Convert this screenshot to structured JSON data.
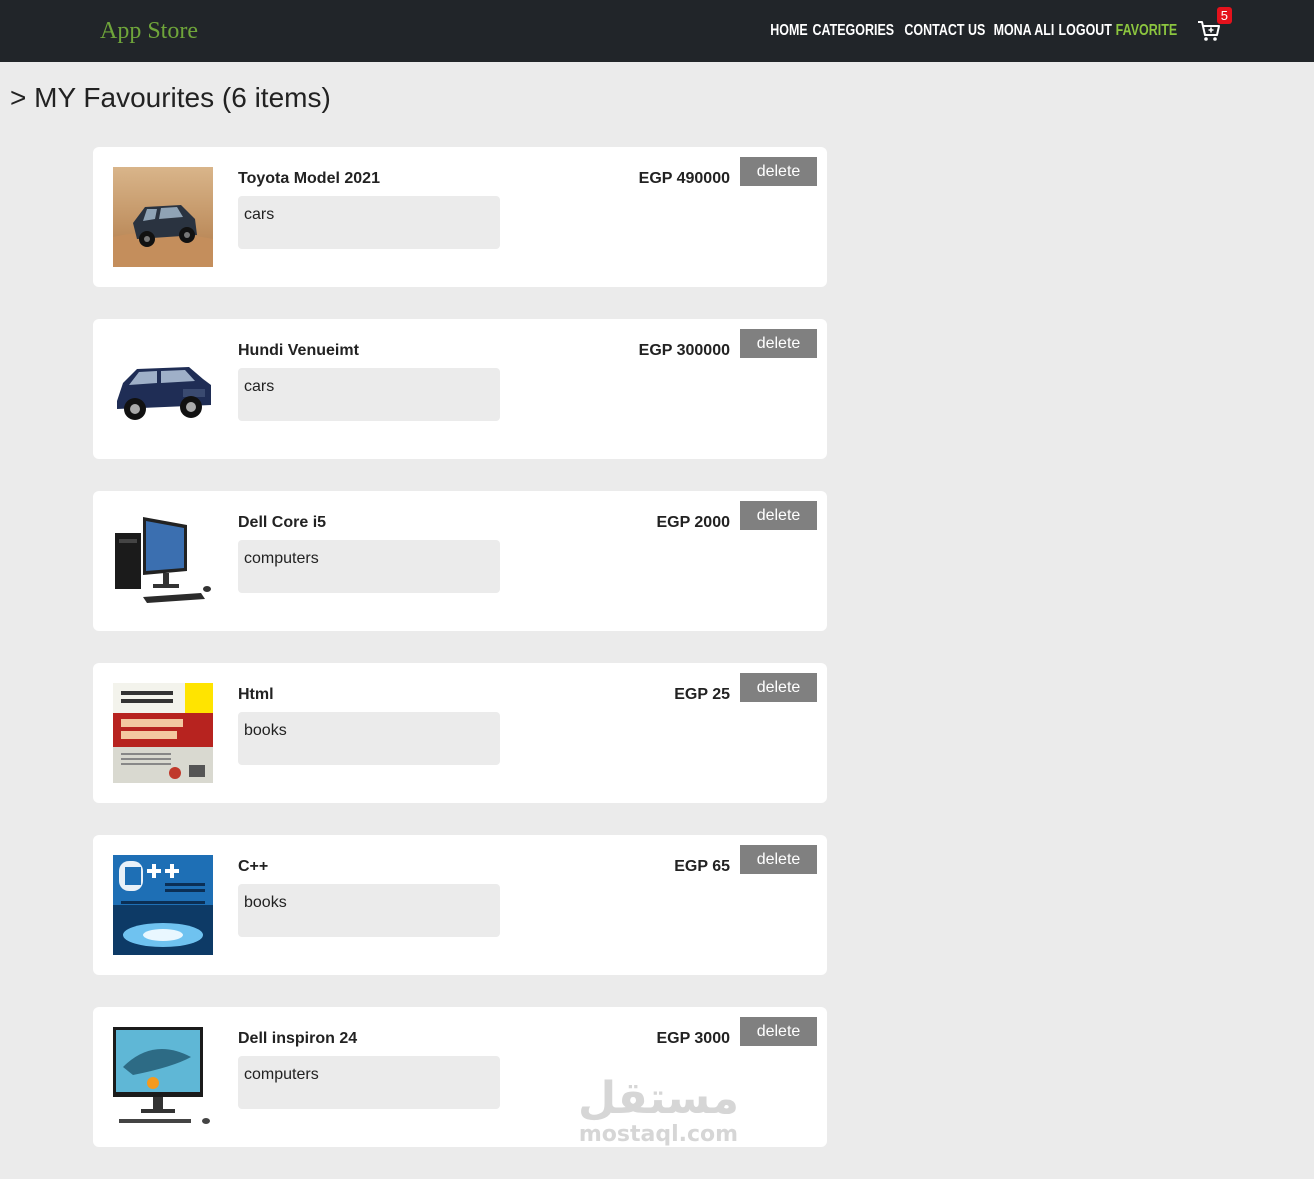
{
  "brand": "App Store",
  "nav": {
    "home": "HOME",
    "categories": "CATEGORIES",
    "contact": "CONTACT US",
    "user": "MONA ALI",
    "logout": "LOGOUT",
    "favorite": "FAVORITE",
    "cart_count": "5"
  },
  "page_title": "> MY Favourites (6 items)",
  "delete_label": "delete",
  "items": [
    {
      "name": "Toyota Model 2021",
      "category": "cars",
      "price": "EGP 490000"
    },
    {
      "name": "Hundi Venueimt",
      "category": "cars",
      "price": "EGP 300000"
    },
    {
      "name": "Dell Core i5",
      "category": "computers",
      "price": "EGP 2000"
    },
    {
      "name": "Html",
      "category": "books",
      "price": "EGP 25"
    },
    {
      "name": "C++",
      "category": "books",
      "price": "EGP 65"
    },
    {
      "name": "Dell inspiron 24",
      "category": "computers",
      "price": "EGP 3000"
    }
  ],
  "watermark": {
    "arabic": "مستقل",
    "latin": "mostaql.com"
  },
  "colors": {
    "navbar": "#212529",
    "brand": "#6fa53a",
    "active_nav": "#8cc63f",
    "badge": "#e4121c",
    "delete_button": "#808080",
    "page_bg": "#ebebeb"
  }
}
